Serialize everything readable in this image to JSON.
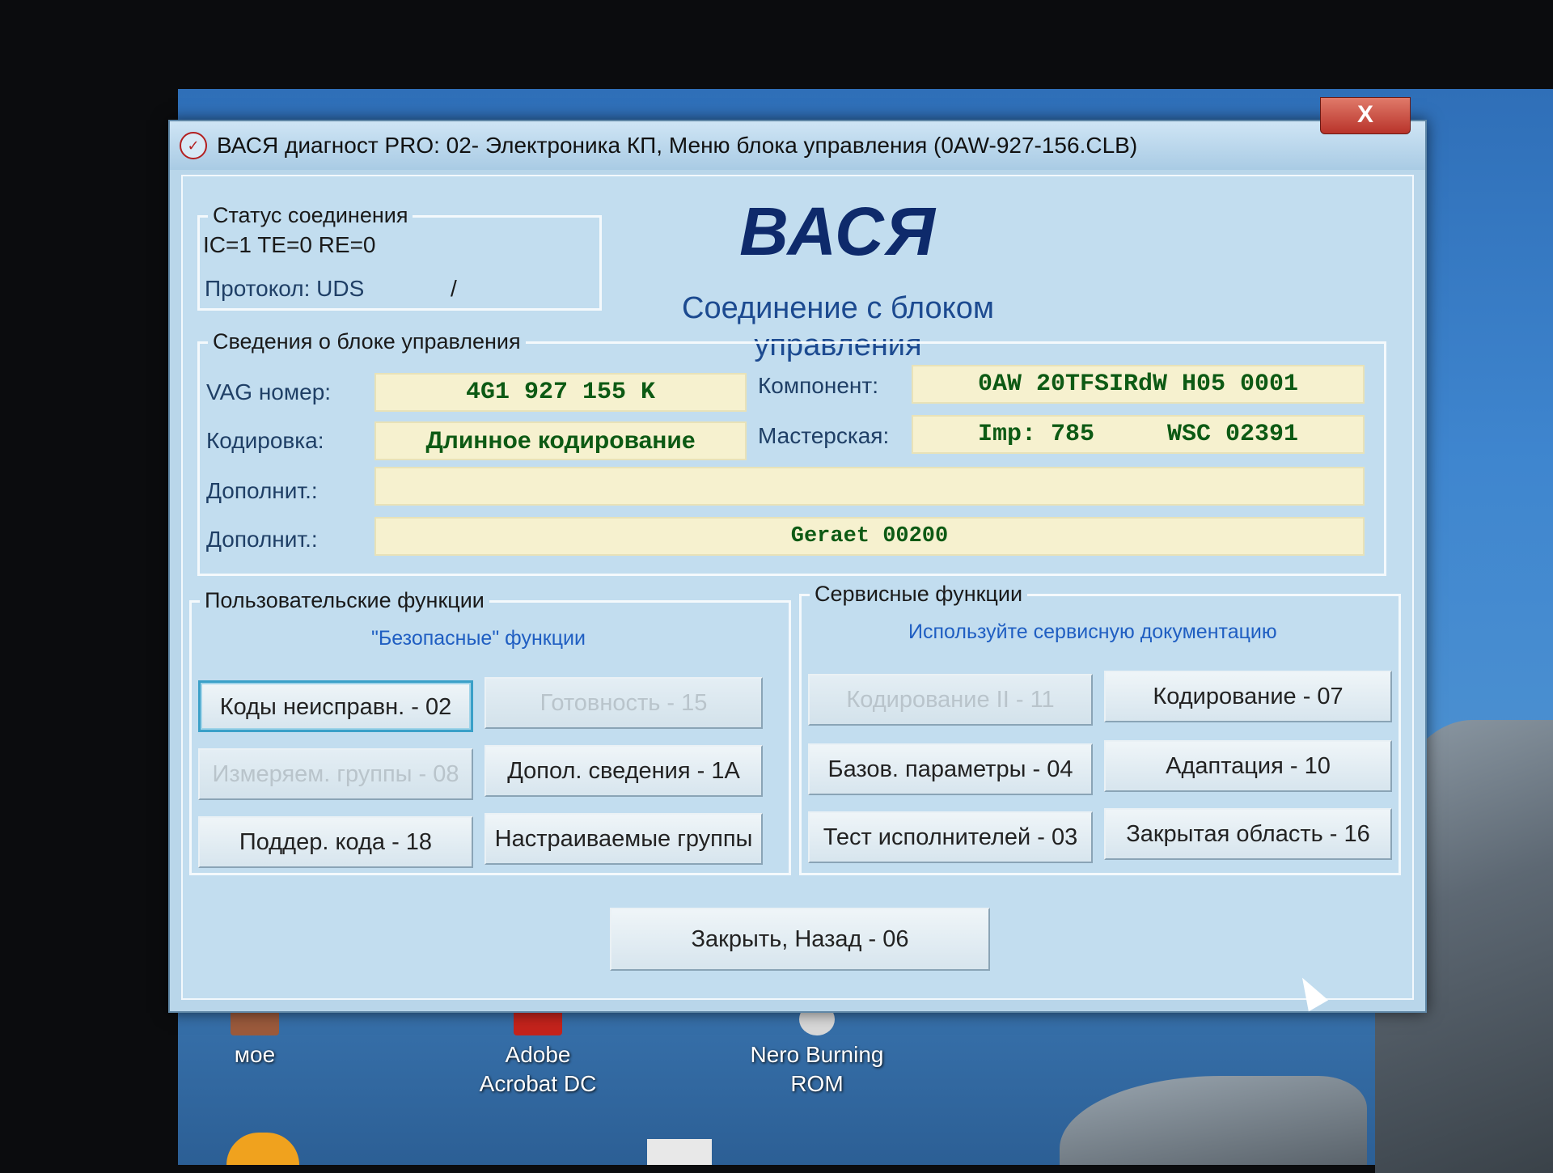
{
  "window": {
    "title": "ВАСЯ диагност PRO: 02- Электроника КП,  Меню блока управления (0AW-927-156.CLB)",
    "close_label": "X",
    "app_icon": "app-logo-icon"
  },
  "brand": {
    "name": "ВАСЯ",
    "subtitle": "Соединение с блоком управления"
  },
  "status": {
    "title": "Статус соединения",
    "line1": "IC=1  TE=0   RE=0",
    "protocol": "Протокол: UDS",
    "separator": "/"
  },
  "ecu": {
    "title": "Сведения о блоке управления",
    "vag_label": "VAG номер:",
    "vag_value": "4G1 927 155 K",
    "coding_label": "Кодировка:",
    "coding_value": "Длинное кодирование",
    "component_label": "Компонент:",
    "component_value": "0AW 20TFSIRdW H05 0001",
    "workshop_label": "Мастерская:",
    "workshop_value": "Imp: 785     WSC 02391",
    "extra1_label": "Дополнит.:",
    "extra1_value": "",
    "extra2_label": "Дополнит.:",
    "extra2_value": "Geraet 00200"
  },
  "user_functions": {
    "title": "Пользовательские функции",
    "hint": "\"Безопасные\" функции",
    "buttons": [
      {
        "label": "Коды неисправн. - 02",
        "enabled": true,
        "focused": true
      },
      {
        "label": "Готовность - 15",
        "enabled": false
      },
      {
        "label": "Измеряем. группы - 08",
        "enabled": false
      },
      {
        "label": "Допол. сведения - 1A",
        "enabled": true
      },
      {
        "label": "Поддер. кода - 18",
        "enabled": true
      },
      {
        "label": "Настраиваемые группы",
        "enabled": true
      }
    ]
  },
  "service_functions": {
    "title": "Сервисные функции",
    "hint": "Используйте сервисную документацию",
    "buttons": [
      {
        "label": "Кодирование II - 11",
        "enabled": false
      },
      {
        "label": "Кодирование - 07",
        "enabled": true
      },
      {
        "label": "Базов. параметры - 04",
        "enabled": true
      },
      {
        "label": "Адаптация - 10",
        "enabled": true
      },
      {
        "label": "Тест исполнителей - 03",
        "enabled": true
      },
      {
        "label": "Закрытая область - 16",
        "enabled": true
      }
    ]
  },
  "close_back": {
    "label": "Закрыть, Назад - 06"
  },
  "desktop": {
    "icons": [
      {
        "label": "мое"
      },
      {
        "label": "Adobe Acrobat DC"
      },
      {
        "label": "Nero Burning ROM"
      }
    ]
  }
}
